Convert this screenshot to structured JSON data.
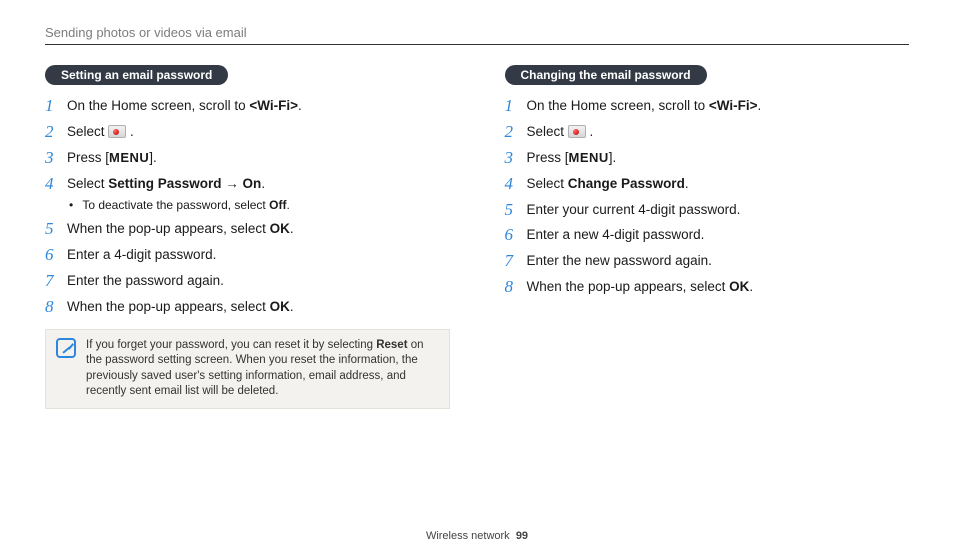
{
  "header": "Sending photos or videos via email",
  "labels": {
    "menu_word": "MENU",
    "select_word": "Select",
    "press_open": "Press [",
    "press_close": "]."
  },
  "left": {
    "pill": "Setting an email password",
    "s1a": "On the Home screen, scroll to ",
    "s1b": "<Wi-Fi>",
    "s1c": ".",
    "s2_tail": " .",
    "s4a": "Select ",
    "s4b": "Setting Password → On",
    "s4c": ".",
    "s4_sub_a": "To deactivate the password, select ",
    "s4_sub_b": "Off",
    "s4_sub_c": ".",
    "s5a": " When the pop-up appears, select ",
    "s5b": "OK",
    "s5c": ".",
    "s6": "Enter a 4-digit password.",
    "s7": "Enter the password again.",
    "s8a": "When the pop-up appears, select ",
    "s8b": "OK",
    "s8c": ".",
    "note_a": "If you forget your password, you can reset it by selecting ",
    "note_b": "Reset",
    "note_c": " on the password setting screen. When you reset the information, the previously saved user's setting information, email address, and recently sent email list will be deleted."
  },
  "right": {
    "pill": "Changing the email password",
    "s1a": "On the Home screen, scroll to ",
    "s1b": "<Wi-Fi>",
    "s1c": ".",
    "s2_tail": " .",
    "s4a": "Select ",
    "s4b": "Change Password",
    "s4c": ".",
    "s5": "Enter your current 4-digit password.",
    "s6": "Enter a new 4-digit password.",
    "s7": "Enter the new password again.",
    "s8a": "When the pop-up appears, select ",
    "s8b": "OK",
    "s8c": "."
  },
  "footer": {
    "section": "Wireless network",
    "page": "99"
  }
}
